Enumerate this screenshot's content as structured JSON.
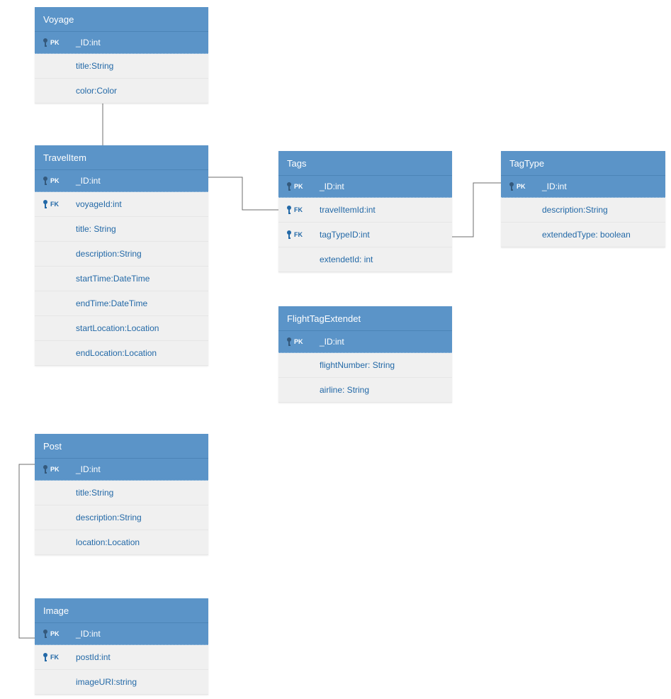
{
  "entities": {
    "voyage": {
      "title": "Voyage",
      "pk": "_ID:int",
      "pk_tag": "PK",
      "attrs": [
        {
          "field": "title:String"
        },
        {
          "field": "color:Color"
        }
      ]
    },
    "travelItem": {
      "title": "TravelItem",
      "pk": "_ID:int",
      "pk_tag": "PK",
      "attrs": [
        {
          "field": "voyageId:int",
          "fk": true,
          "tag": "FK"
        },
        {
          "field": "title: String"
        },
        {
          "field": "description:String"
        },
        {
          "field": "startTime:DateTime"
        },
        {
          "field": "endTime:DateTime"
        },
        {
          "field": "startLocation:Location"
        },
        {
          "field": "endLocation:Location"
        }
      ]
    },
    "tags": {
      "title": "Tags",
      "pk": "_ID:int",
      "pk_tag": "PK",
      "attrs": [
        {
          "field": "travelItemId:int",
          "fk": true,
          "tag": "FK"
        },
        {
          "field": "tagTypeID:int",
          "fk": true,
          "tag": "FK"
        },
        {
          "field": "extendetId: int"
        }
      ]
    },
    "tagType": {
      "title": "TagType",
      "pk": "_ID:int",
      "pk_tag": "PK",
      "attrs": [
        {
          "field": "description:String"
        },
        {
          "field": "extendedType: boolean"
        }
      ]
    },
    "flightTagExtendet": {
      "title": "FlightTagExtendet",
      "pk": "_ID:int",
      "pk_tag": "PK",
      "attrs": [
        {
          "field": "flightNumber: String"
        },
        {
          "field": "airline: String"
        }
      ]
    },
    "post": {
      "title": "Post",
      "pk": "_ID:int",
      "pk_tag": "PK",
      "attrs": [
        {
          "field": "title:String"
        },
        {
          "field": "description:String"
        },
        {
          "field": "location:Location"
        }
      ]
    },
    "image": {
      "title": "Image",
      "pk": "_ID:int",
      "pk_tag": "PK",
      "attrs": [
        {
          "field": "postId:int",
          "fk": true,
          "tag": "FK"
        },
        {
          "field": "imageURI:string"
        }
      ]
    }
  }
}
